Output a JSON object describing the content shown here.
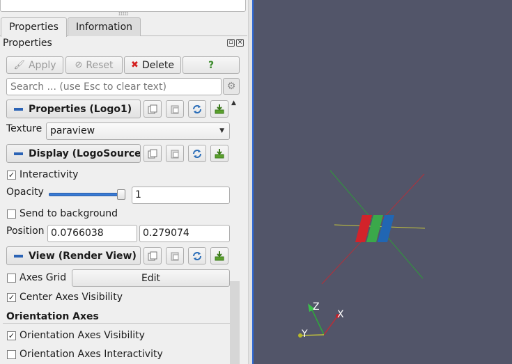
{
  "tabs": [
    {
      "label": "Properties",
      "active": true
    },
    {
      "label": "Information",
      "active": false
    }
  ],
  "panel": {
    "title": "Properties",
    "float_icon": "float-icon",
    "close_icon": "close-icon"
  },
  "actions": {
    "apply": "Apply",
    "reset": "Reset",
    "delete": "Delete",
    "help": "?"
  },
  "search": {
    "placeholder": "Search ... (use Esc to clear text)"
  },
  "sections": {
    "properties": "Properties (Logo1)",
    "display": "Display (LogoSourceRepresentation)",
    "view": "View (Render View)"
  },
  "properties": {
    "texture_label": "Texture",
    "texture_value": "paraview"
  },
  "display": {
    "interactivity_label": "Interactivity",
    "interactivity_checked": true,
    "opacity_label": "Opacity",
    "opacity_value": "1",
    "opacity_level": 1.0,
    "send_to_background_label": "Send to background",
    "send_to_background_checked": false,
    "position_label": "Position",
    "position_x": "0.0766038",
    "position_y": "0.279074"
  },
  "view": {
    "axes_grid_label": "Axes Grid",
    "axes_grid_checked": false,
    "edit_label": "Edit",
    "center_axes_label": "Center Axes Visibility",
    "center_axes_checked": true,
    "orientation_header": "Orientation Axes",
    "orientation_visibility_label": "Orientation Axes Visibility",
    "orientation_visibility_checked": true,
    "orientation_interactivity_label": "Orientation Axes Interactivity",
    "orientation_interactivity_checked": false
  },
  "render_view": {
    "background": "#525569",
    "axis_labels": {
      "x": "X",
      "y": "Y",
      "z": "Z"
    },
    "logo_colors": [
      "#d2232a",
      "#3aa84a",
      "#2166b3"
    ]
  }
}
